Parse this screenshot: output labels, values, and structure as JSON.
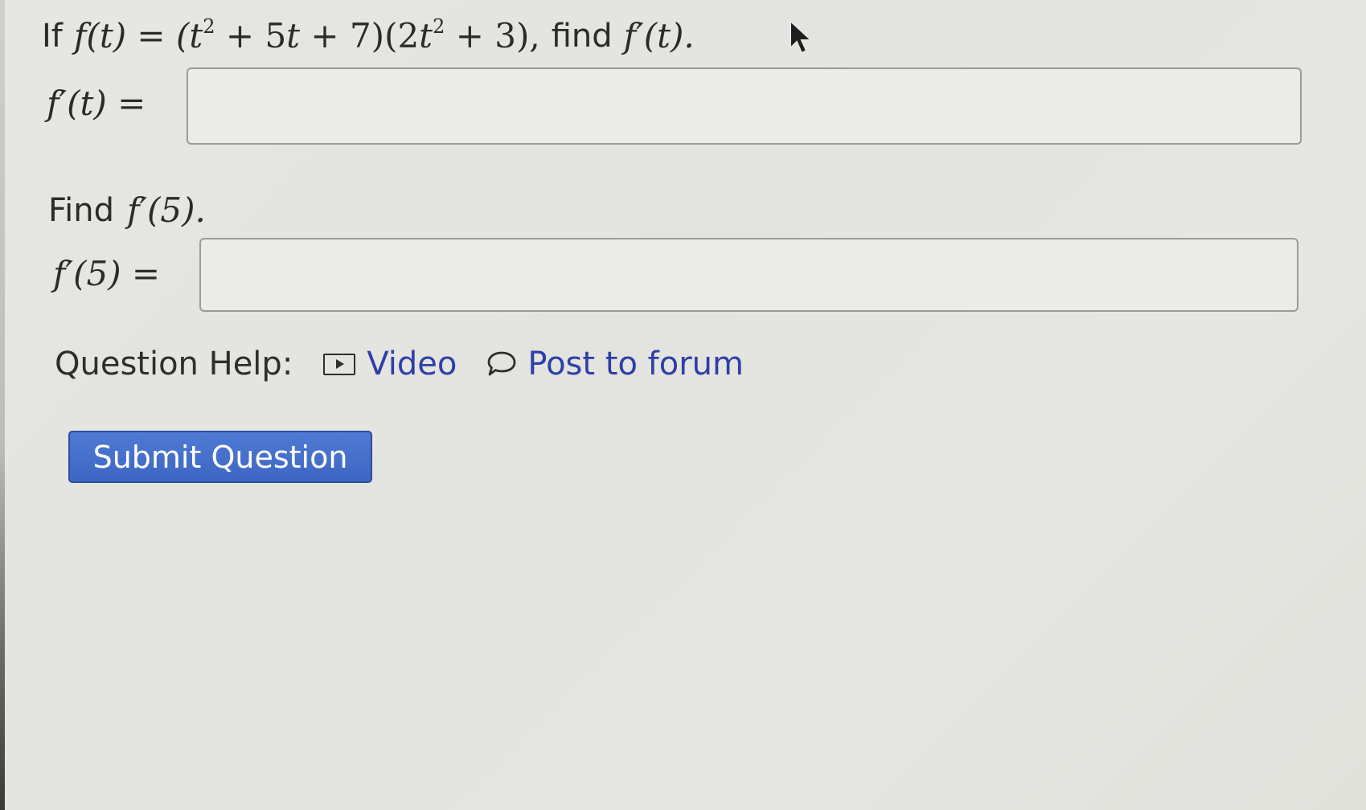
{
  "question": {
    "part1": {
      "prefix": "If",
      "f_t": "f(t) = (",
      "t_var": "t",
      "exp1": "2",
      "mid1": " + 5",
      "t_var2": "t",
      "mid2": " + 7)(2",
      "t_var3": "t",
      "exp2": "2",
      "mid3": " + 3),",
      "find_word": "find",
      "target": "f′(t)."
    },
    "answer1_label": "f′(t) =",
    "part2": {
      "find_word": "Find",
      "target": "f′(5)."
    },
    "answer2_label": "f′(5) ="
  },
  "help": {
    "label": "Question Help:",
    "video_label": "Video",
    "forum_label": "Post to forum",
    "link_color": "#2d3fa8"
  },
  "submit": {
    "label": "Submit Question",
    "color": "#4571cc"
  },
  "icons": {
    "video": "video-icon",
    "forum": "speech-bubble-icon",
    "cursor": "mouse-pointer-icon"
  }
}
